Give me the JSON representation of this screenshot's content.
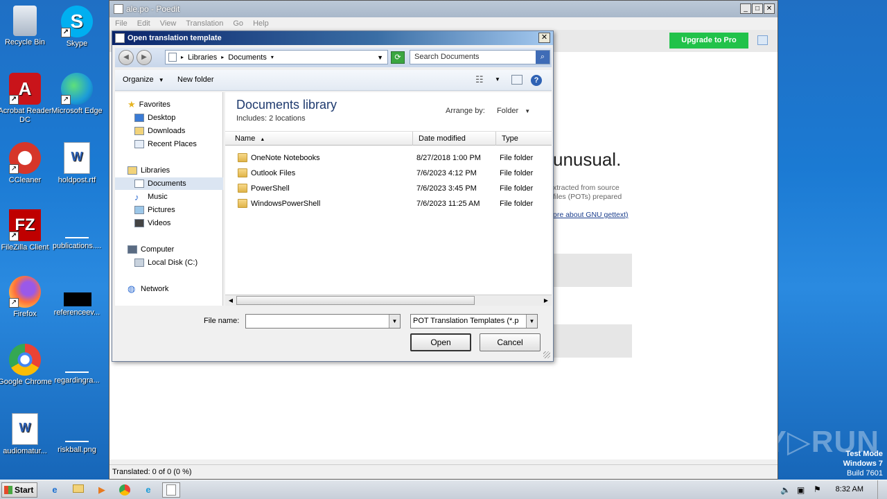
{
  "desktop": {
    "icons": [
      {
        "label": "Recycle Bin",
        "glyph": "🗑",
        "color": "#cfd8e3"
      },
      {
        "label": "Skype",
        "glyph": "S",
        "color": "#00aff0"
      },
      {
        "label": "Acrobat Reader DC",
        "glyph": "A",
        "color": "#d2232a"
      },
      {
        "label": "Microsoft Edge",
        "glyph": "e",
        "color": "#1c9cd8"
      },
      {
        "label": "CCleaner",
        "glyph": "C",
        "color": "#d6362a"
      },
      {
        "label": "holdpost.rtf",
        "glyph": "W",
        "color": "#2b5fb4"
      },
      {
        "label": "FileZilla Client",
        "glyph": "FZ",
        "color": "#bf0000"
      },
      {
        "label": "publications....",
        "glyph": "",
        "color": "#ffffff"
      },
      {
        "label": "Firefox",
        "glyph": "🦊",
        "color": "#ff7139"
      },
      {
        "label": "referenceev...",
        "glyph": "",
        "color": "#000000"
      },
      {
        "label": "Google Chrome",
        "glyph": "◉",
        "color": "#4285f4"
      },
      {
        "label": "regardingra...",
        "glyph": "",
        "color": "#ffffff"
      },
      {
        "label": "audiomatur...",
        "glyph": "W",
        "color": "#2b5fb4"
      },
      {
        "label": "riskball.png",
        "glyph": "",
        "color": "#ffffff"
      }
    ]
  },
  "poedit": {
    "title": "ale.po - Poedit",
    "menu": [
      "File",
      "Edit",
      "View",
      "Translation",
      "Go",
      "Help"
    ],
    "upgrade_label": "Upgrade to Pro",
    "heading_fragment": "unusual.",
    "desc_line1": "xtracted from source",
    "desc_line2": "files (POTs) prepared",
    "link_fragment": "ore about GNU gettext)",
    "status": "Translated: 0 of 0 (0 %)"
  },
  "dialog": {
    "title": "Open translation template",
    "breadcrumb": [
      "Libraries",
      "Documents"
    ],
    "search_placeholder": "Search Documents",
    "organize_label": "Organize",
    "new_folder_label": "New folder",
    "nav": {
      "favorites": "Favorites",
      "desktop": "Desktop",
      "downloads": "Downloads",
      "recent": "Recent Places",
      "libraries": "Libraries",
      "documents": "Documents",
      "music": "Music",
      "pictures": "Pictures",
      "videos": "Videos",
      "computer": "Computer",
      "localdisk": "Local Disk (C:)",
      "network": "Network"
    },
    "library_title": "Documents library",
    "library_includes": "Includes:  2 locations",
    "arrange_by_label": "Arrange by:",
    "arrange_by_value": "Folder",
    "columns": {
      "name": "Name",
      "date": "Date modified",
      "type": "Type"
    },
    "files": [
      {
        "name": "OneNote Notebooks",
        "date": "8/27/2018 1:00 PM",
        "type": "File folder"
      },
      {
        "name": "Outlook Files",
        "date": "7/6/2023 4:12 PM",
        "type": "File folder"
      },
      {
        "name": "PowerShell",
        "date": "7/6/2023 3:45 PM",
        "type": "File folder"
      },
      {
        "name": "WindowsPowerShell",
        "date": "7/6/2023 11:25 AM",
        "type": "File folder"
      }
    ],
    "file_name_label": "File name:",
    "file_name_value": "",
    "filter_value": "POT Translation Templates (*.p",
    "open_label": "Open",
    "cancel_label": "Cancel"
  },
  "watermark": {
    "text": "ANY▷RUN",
    "test_mode": "Test Mode",
    "os": "Windows 7",
    "build": "Build 7601"
  },
  "taskbar": {
    "start_label": "Start",
    "clock": "8:32 AM"
  }
}
